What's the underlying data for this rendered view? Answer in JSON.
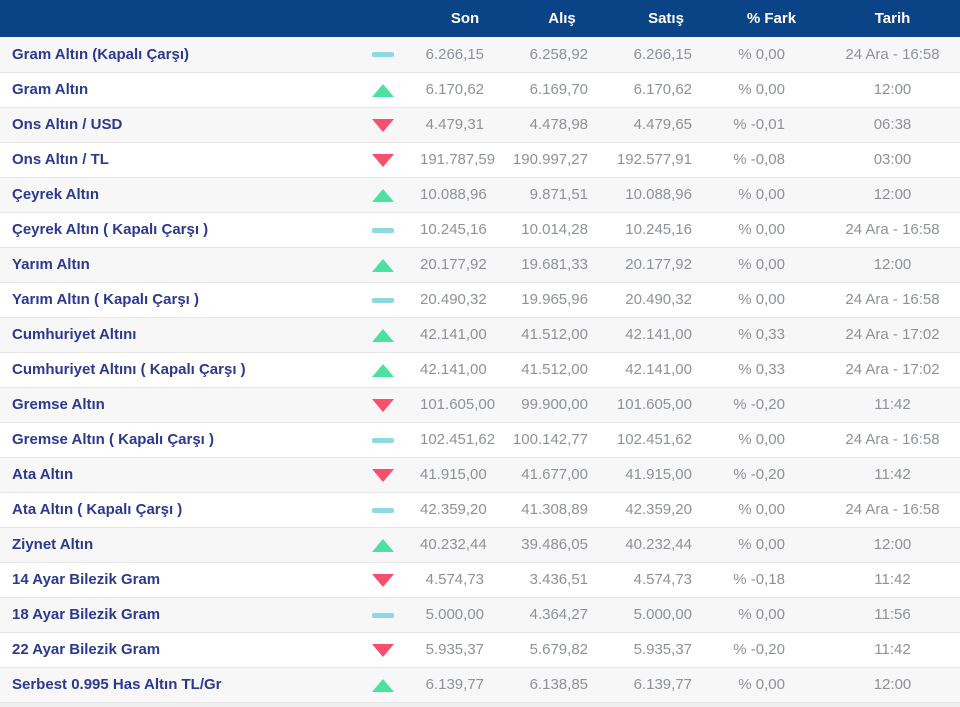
{
  "table": {
    "columns": {
      "son": "Son",
      "alis": "Alış",
      "satis": "Satış",
      "fark": "% Fark",
      "tarih": "Tarih"
    },
    "rows": [
      {
        "name": "Gram Altın (Kapalı Çarşı)",
        "trend": "flat",
        "son": "6.266,15",
        "alis": "6.258,92",
        "satis": "6.266,15",
        "fark": "% 0,00",
        "tarih": "24 Ara - 16:58"
      },
      {
        "name": "Gram Altın",
        "trend": "up",
        "son": "6.170,62",
        "alis": "6.169,70",
        "satis": "6.170,62",
        "fark": "% 0,00",
        "tarih": "12:00"
      },
      {
        "name": "Ons Altın / USD",
        "trend": "down",
        "son": "4.479,31",
        "alis": "4.478,98",
        "satis": "4.479,65",
        "fark": "% -0,01",
        "tarih": "06:38"
      },
      {
        "name": "Ons Altın / TL",
        "trend": "down",
        "son": "191.787,59",
        "alis": "190.997,27",
        "satis": "192.577,91",
        "fark": "% -0,08",
        "tarih": "03:00"
      },
      {
        "name": "Çeyrek Altın",
        "trend": "up",
        "son": "10.088,96",
        "alis": "9.871,51",
        "satis": "10.088,96",
        "fark": "% 0,00",
        "tarih": "12:00"
      },
      {
        "name": "Çeyrek Altın ( Kapalı Çarşı )",
        "trend": "flat",
        "son": "10.245,16",
        "alis": "10.014,28",
        "satis": "10.245,16",
        "fark": "% 0,00",
        "tarih": "24 Ara - 16:58"
      },
      {
        "name": "Yarım Altın",
        "trend": "up",
        "son": "20.177,92",
        "alis": "19.681,33",
        "satis": "20.177,92",
        "fark": "% 0,00",
        "tarih": "12:00"
      },
      {
        "name": "Yarım Altın ( Kapalı Çarşı )",
        "trend": "flat",
        "son": "20.490,32",
        "alis": "19.965,96",
        "satis": "20.490,32",
        "fark": "% 0,00",
        "tarih": "24 Ara - 16:58"
      },
      {
        "name": "Cumhuriyet Altını",
        "trend": "up",
        "son": "42.141,00",
        "alis": "41.512,00",
        "satis": "42.141,00",
        "fark": "% 0,33",
        "tarih": "24 Ara - 17:02"
      },
      {
        "name": "Cumhuriyet Altını ( Kapalı Çarşı )",
        "trend": "up",
        "son": "42.141,00",
        "alis": "41.512,00",
        "satis": "42.141,00",
        "fark": "% 0,33",
        "tarih": "24 Ara - 17:02"
      },
      {
        "name": "Gremse Altın",
        "trend": "down",
        "son": "101.605,00",
        "alis": "99.900,00",
        "satis": "101.605,00",
        "fark": "% -0,20",
        "tarih": "11:42"
      },
      {
        "name": "Gremse Altın ( Kapalı Çarşı )",
        "trend": "flat",
        "son": "102.451,62",
        "alis": "100.142,77",
        "satis": "102.451,62",
        "fark": "% 0,00",
        "tarih": "24 Ara - 16:58"
      },
      {
        "name": "Ata Altın",
        "trend": "down",
        "son": "41.915,00",
        "alis": "41.677,00",
        "satis": "41.915,00",
        "fark": "% -0,20",
        "tarih": "11:42"
      },
      {
        "name": "Ata Altın ( Kapalı Çarşı )",
        "trend": "flat",
        "son": "42.359,20",
        "alis": "41.308,89",
        "satis": "42.359,20",
        "fark": "% 0,00",
        "tarih": "24 Ara - 16:58"
      },
      {
        "name": "Ziynet Altın",
        "trend": "up",
        "son": "40.232,44",
        "alis": "39.486,05",
        "satis": "40.232,44",
        "fark": "% 0,00",
        "tarih": "12:00"
      },
      {
        "name": "14 Ayar Bilezik Gram",
        "trend": "down",
        "son": "4.574,73",
        "alis": "3.436,51",
        "satis": "4.574,73",
        "fark": "% -0,18",
        "tarih": "11:42"
      },
      {
        "name": "18 Ayar Bilezik Gram",
        "trend": "flat",
        "son": "5.000,00",
        "alis": "4.364,27",
        "satis": "5.000,00",
        "fark": "% 0,00",
        "tarih": "11:56"
      },
      {
        "name": "22 Ayar Bilezik Gram",
        "trend": "down",
        "son": "5.935,37",
        "alis": "5.679,82",
        "satis": "5.935,37",
        "fark": "% -0,20",
        "tarih": "11:42"
      },
      {
        "name": "Serbest 0.995 Has Altın TL/Gr",
        "trend": "up",
        "son": "6.139,77",
        "alis": "6.138,85",
        "satis": "6.139,77",
        "fark": "% 0,00",
        "tarih": "12:00"
      }
    ]
  },
  "colors": {
    "header_bg": "#0a4386",
    "name_text": "#2b3a8f",
    "value_text": "#8d9199",
    "stripe_bg": "#f7f7f7",
    "row_border": "#e7e7e7",
    "trend_up": "#4ce0a3",
    "trend_down": "#f6506e",
    "trend_flat": "#8ed8e4",
    "bottom_strip": "#efefef"
  }
}
